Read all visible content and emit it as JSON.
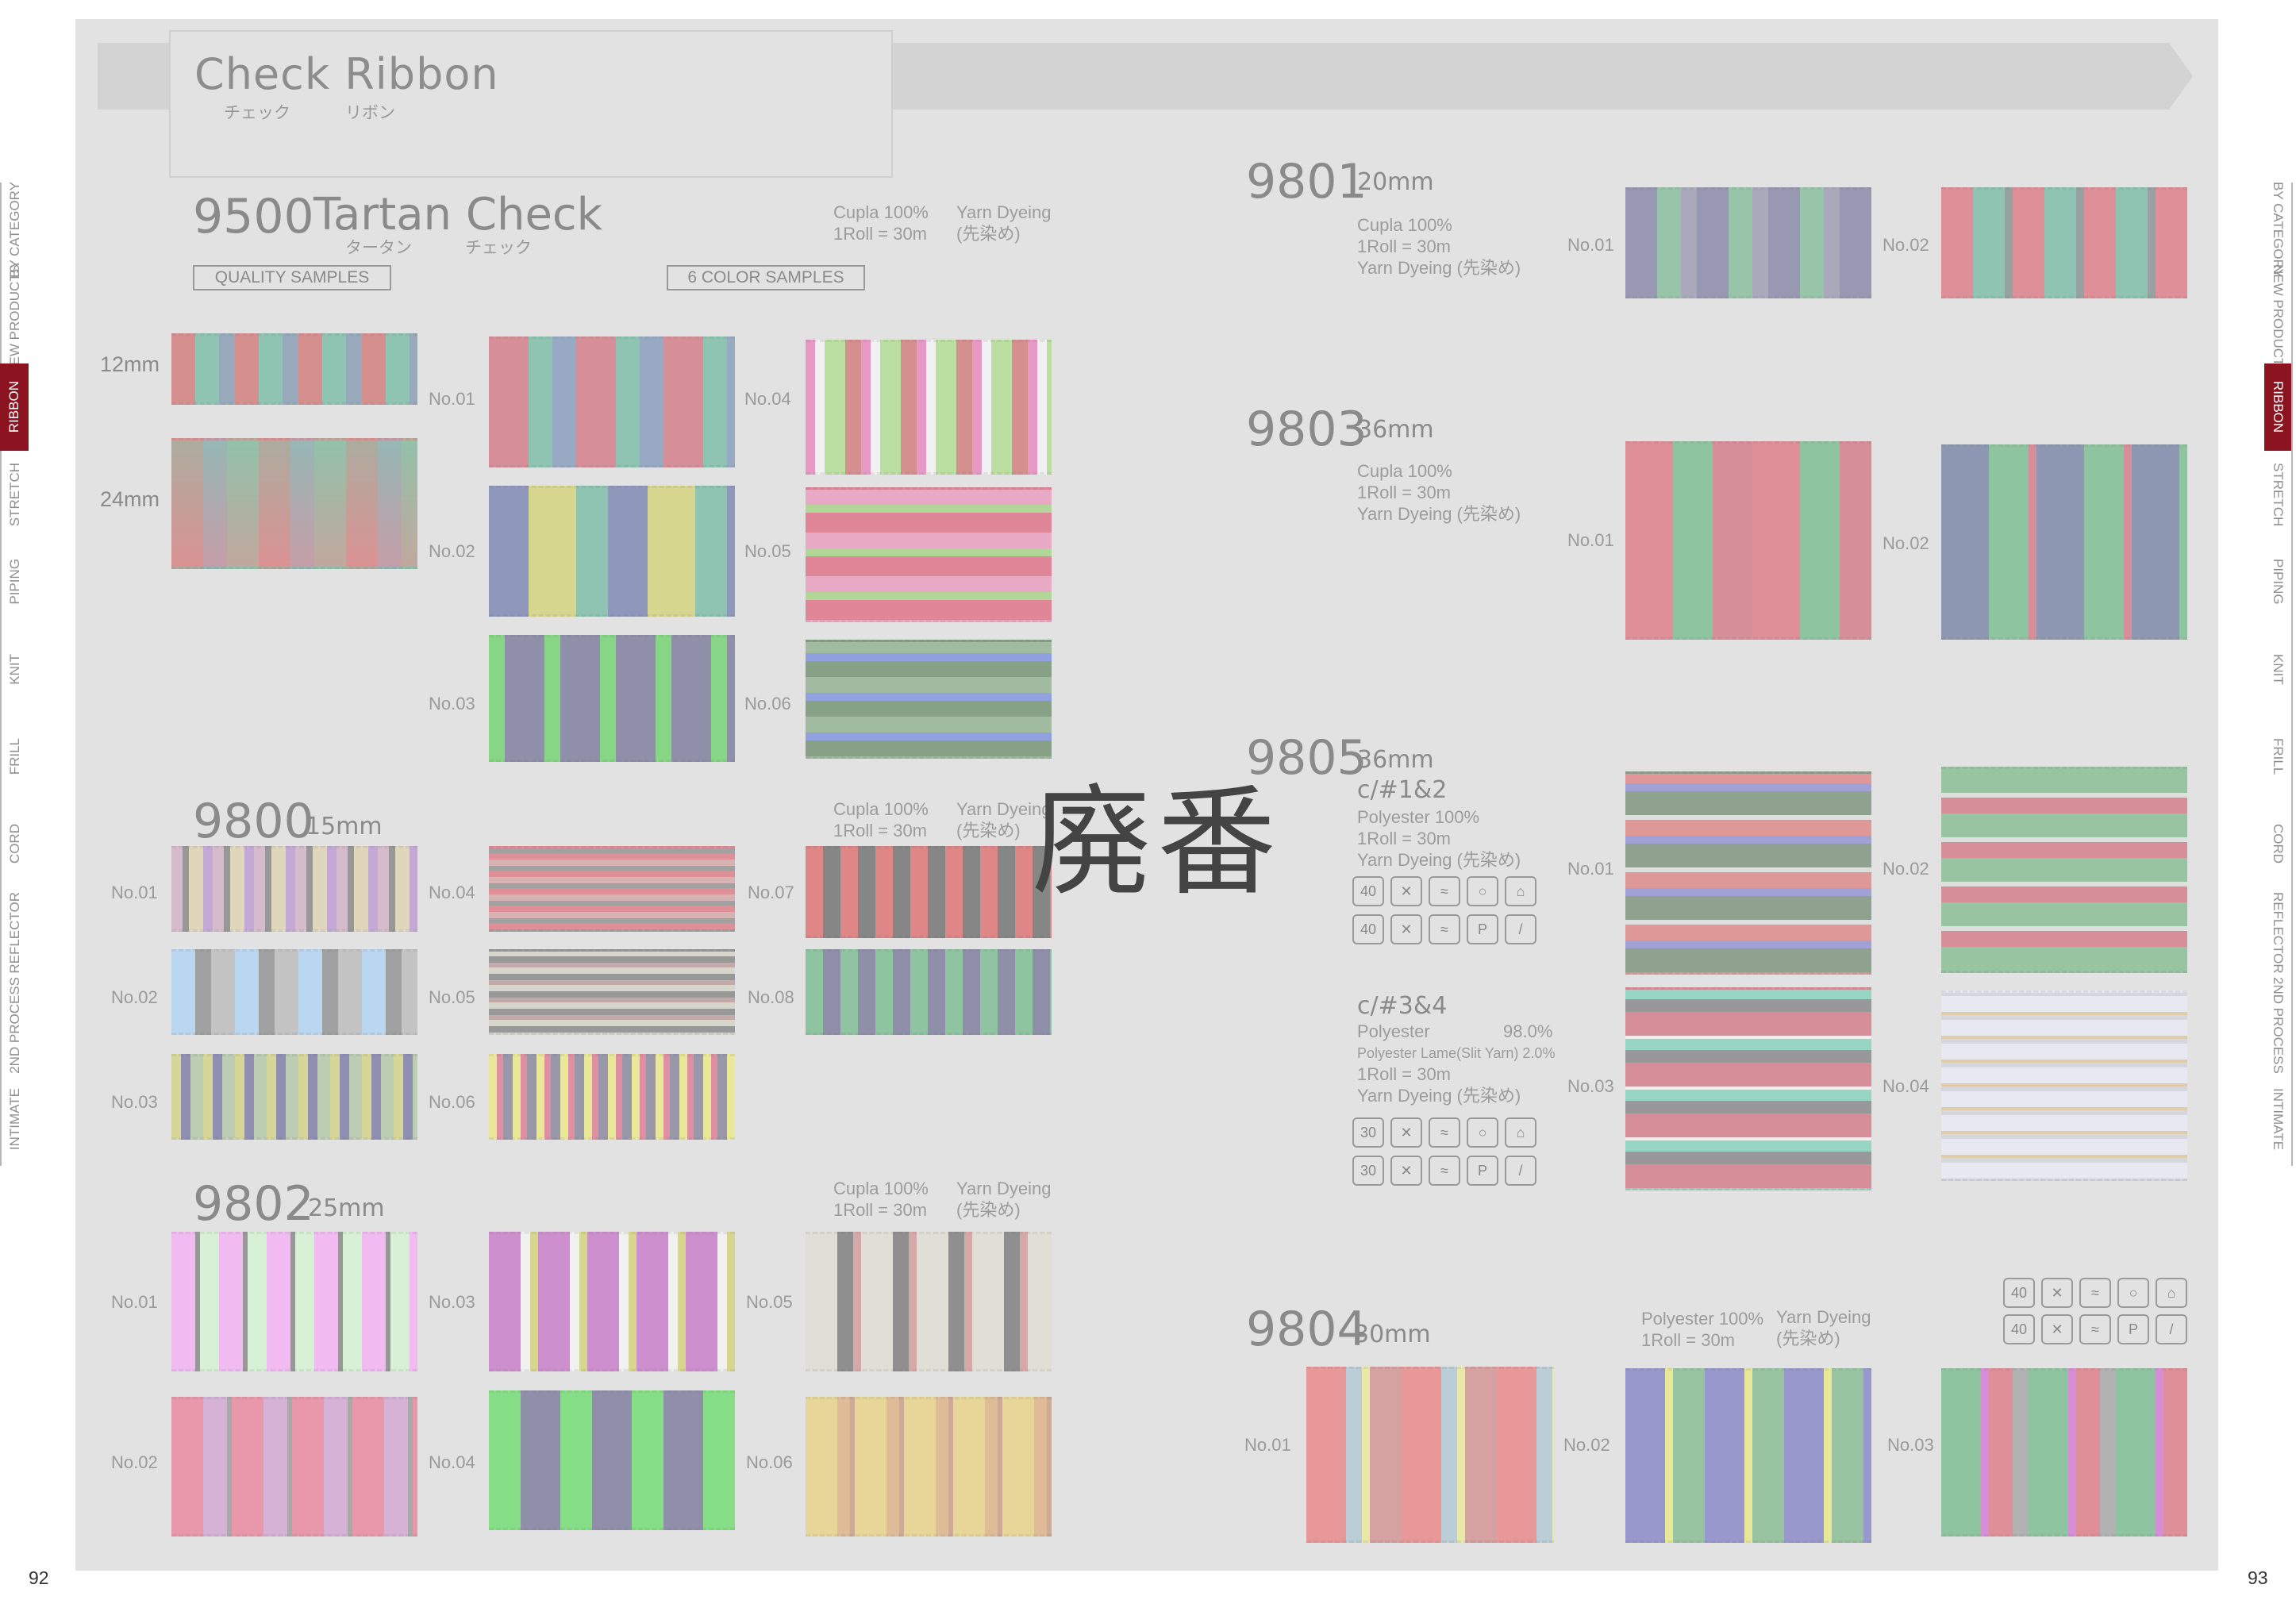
{
  "header": {
    "title": "Check Ribbon",
    "title_kana_1": "チェック",
    "title_kana_2": "リボン"
  },
  "watermark": "廃番",
  "pages": {
    "left": "92",
    "right": "93"
  },
  "left_tabs": [
    "BY CATEGORY",
    "NEW PRODUCTS",
    "RIBBON",
    "STRETCH",
    "PIPING",
    "KNIT",
    "FRILL",
    "CORD",
    "REFLECTOR",
    "2ND PROCESS",
    "INTIMATE"
  ],
  "right_tabs": [
    "BY CATEGORY",
    "NEW PRODUCTS",
    "RIBBON",
    "STRETCH",
    "PIPING",
    "KNIT",
    "FRILL",
    "CORD",
    "REFLECTOR",
    "2ND PROCESS",
    "INTIMATE"
  ],
  "p9500": {
    "num": "9500",
    "name": "Tartan Check",
    "kana1": "タータン",
    "kana2": "チェック",
    "spec1": "Cupla 100%\n1Roll = 30m",
    "spec2": "Yarn Dyeing\n(先染め)",
    "quality": "QUALITY SAMPLES",
    "colors": "6 COLOR SAMPLES",
    "size1": "12mm",
    "size2": "24mm",
    "labels": [
      "No.01",
      "No.02",
      "No.03",
      "No.04",
      "No.05",
      "No.06"
    ]
  },
  "p9800": {
    "num": "9800",
    "mm": "15mm",
    "spec1": "Cupla 100%\n1Roll = 30m",
    "spec2": "Yarn Dyeing\n(先染め)",
    "labels": [
      "No.01",
      "No.02",
      "No.03",
      "No.04",
      "No.05",
      "No.06",
      "No.07",
      "No.08"
    ]
  },
  "p9802": {
    "num": "9802",
    "mm": "25mm",
    "spec1": "Cupla 100%\n1Roll = 30m",
    "spec2": "Yarn Dyeing\n(先染め)",
    "labels": [
      "No.01",
      "No.02",
      "No.03",
      "No.04",
      "No.05",
      "No.06"
    ]
  },
  "p9801": {
    "num": "9801",
    "mm": "20mm",
    "spec": "Cupla 100%\n1Roll = 30m\nYarn Dyeing (先染め)",
    "labels": [
      "No.01",
      "No.02"
    ]
  },
  "p9803": {
    "num": "9803",
    "mm": "36mm",
    "spec": "Cupla 100%\n1Roll = 30m\nYarn Dyeing (先染め)",
    "labels": [
      "No.01",
      "No.02"
    ]
  },
  "p9805": {
    "num": "9805",
    "mm": "36mm",
    "c12": "c/#1&2",
    "spec12": "Polyester 100%\n1Roll = 30m\nYarn Dyeing (先染め)",
    "c34": "c/#3&4",
    "spec34a": "Polyester",
    "spec34a_pct": "98.0%",
    "spec34b": "Polyester Lame(Slit Yarn) 2.0%",
    "spec34c": "1Roll = 30m\nYarn Dyeing (先染め)",
    "labels": [
      "No.01",
      "No.02",
      "No.03",
      "No.04"
    ]
  },
  "p9804": {
    "num": "9804",
    "mm": "30mm",
    "spec1": "Polyester 100%\n1Roll = 30m",
    "spec2": "Yarn Dyeing\n(先染め)",
    "labels": [
      "No.01",
      "No.02",
      "No.03"
    ]
  },
  "care": {
    "row1": [
      "40",
      "✕",
      "≈",
      "○",
      "⌂"
    ],
    "row1b": [
      "30",
      "✕",
      "≈",
      "○",
      "⌂"
    ],
    "row2": [
      "40",
      "✕",
      "≈",
      "P",
      "/"
    ],
    "row2b": [
      "30",
      "✕",
      "≈",
      "P",
      "/"
    ]
  },
  "colors": {
    "panel": "#e2e2e2",
    "active_tab": "#8b1420"
  }
}
